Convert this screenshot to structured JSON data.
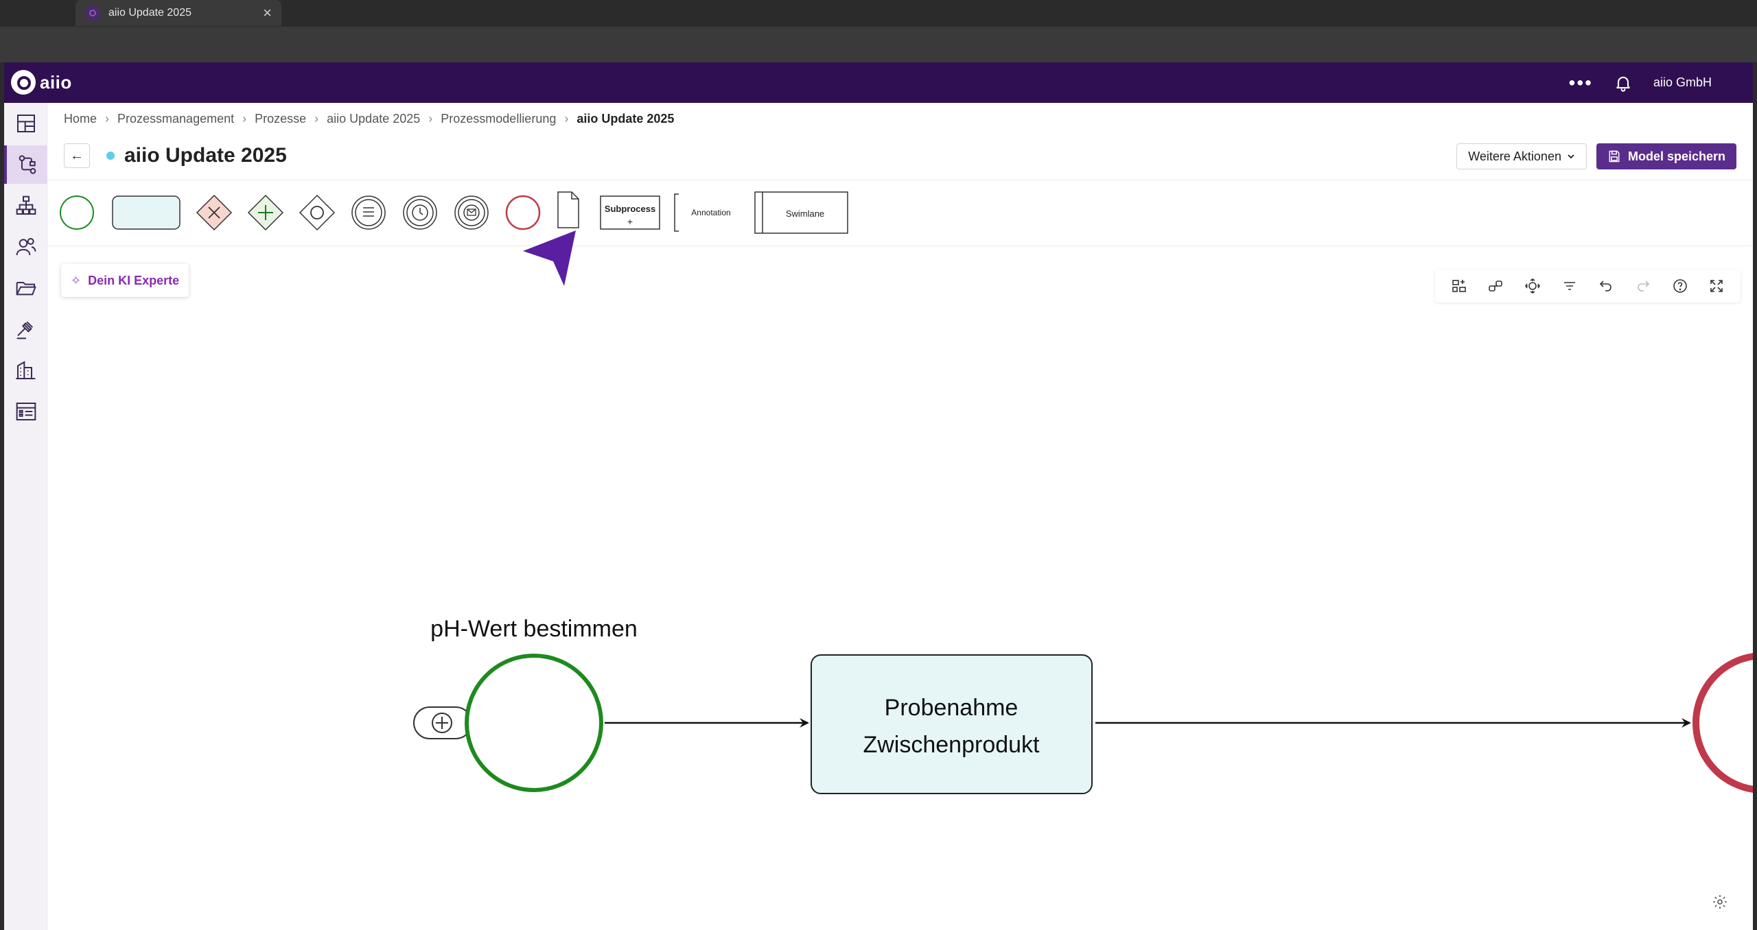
{
  "browser": {
    "tab_title": "aiio Update 2025",
    "tab_close": "×"
  },
  "header": {
    "logo_text": "aiio",
    "more_label": "•••",
    "org_name": "aiio GmbH",
    "bg_color": "#2f0f51"
  },
  "sidebar": {
    "items": [
      {
        "name": "dashboard-icon",
        "active": false
      },
      {
        "name": "process-icon",
        "active": true
      },
      {
        "name": "org-chart-icon",
        "active": false
      },
      {
        "name": "people-icon",
        "active": false
      },
      {
        "name": "folder-icon",
        "active": false
      },
      {
        "name": "gavel-icon",
        "active": false
      },
      {
        "name": "building-icon",
        "active": false
      },
      {
        "name": "list-table-icon",
        "active": false
      }
    ]
  },
  "breadcrumb": [
    "Home",
    "Prozessmanagement",
    "Prozesse",
    "aiio Update 2025",
    "Prozessmodellierung",
    "aiio Update 2025"
  ],
  "page": {
    "back_label": "←",
    "title": "aiio Update 2025",
    "more_actions_label": "Weitere Aktionen",
    "save_label": "Model speichern"
  },
  "palette": {
    "subprocess_label": "Subprocess",
    "subprocess_plus": "+",
    "annotation_label": "Annotation",
    "swimlane_label": "Swimlane"
  },
  "ki_assistant": {
    "label": "Dein KI Experte"
  },
  "canvas_tools": [
    "auto-layout-icon",
    "link-icon",
    "center-icon",
    "filter-icon",
    "undo-icon",
    "redo-icon",
    "help-icon",
    "fullscreen-icon"
  ],
  "diagram": {
    "start_event_label": "pH-Wert bestimmen",
    "task_label_line1": "Probenahme",
    "task_label_line2": "Zwischenprodukt",
    "start_color": "#1e8a1e",
    "task_fill": "#e6f6f6",
    "end_color": "#c0394a"
  }
}
